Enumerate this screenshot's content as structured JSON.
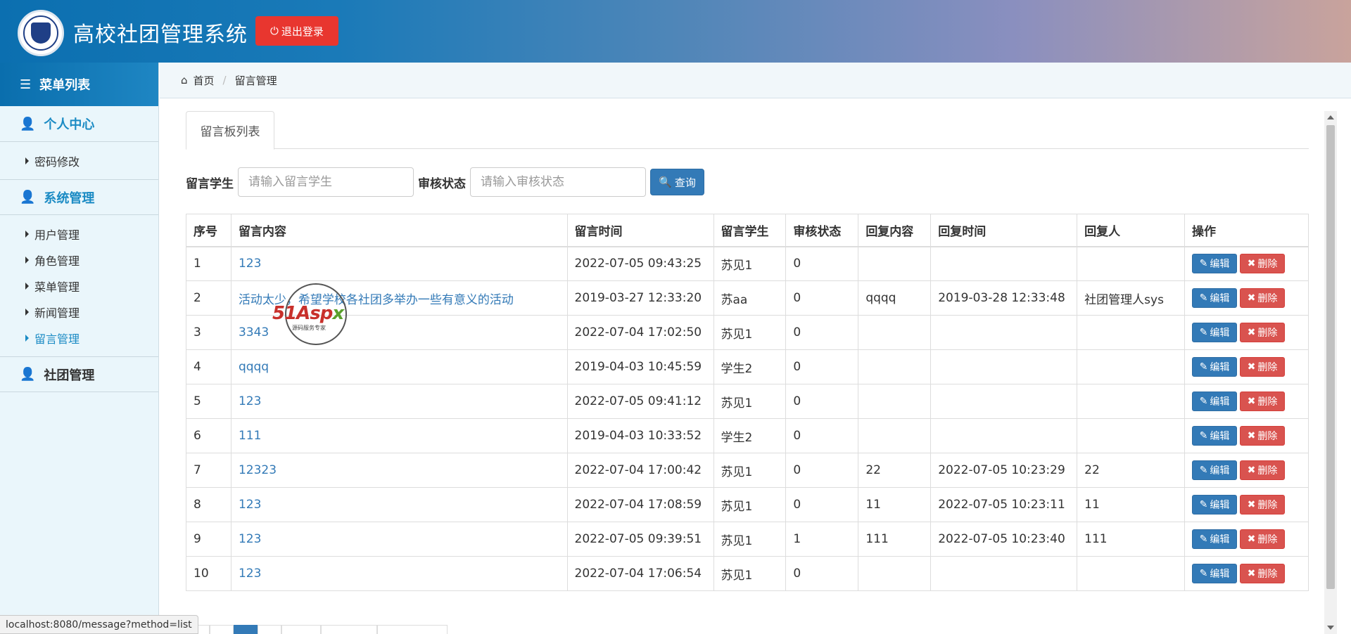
{
  "header": {
    "title": "高校社团管理系统",
    "logout_label": "退出登录"
  },
  "sidebar": {
    "menu_title": "菜单列表",
    "groups": [
      {
        "label": "个人中心",
        "items": [
          {
            "label": "密码修改"
          }
        ]
      },
      {
        "label": "系统管理",
        "items": [
          {
            "label": "用户管理"
          },
          {
            "label": "角色管理"
          },
          {
            "label": "菜单管理"
          },
          {
            "label": "新闻管理"
          },
          {
            "label": "留言管理"
          }
        ]
      },
      {
        "label": "社团管理",
        "items": []
      }
    ]
  },
  "breadcrumb": {
    "home": "首页",
    "current": "留言管理"
  },
  "tab_label": "留言板列表",
  "search": {
    "student_label": "留言学生",
    "student_placeholder": "请输入留言学生",
    "status_label": "审核状态",
    "status_placeholder": "请输入审核状态",
    "query_label": "查询"
  },
  "table": {
    "headers": [
      "序号",
      "留言内容",
      "留言时间",
      "留言学生",
      "审核状态",
      "回复内容",
      "回复时间",
      "回复人",
      "操作"
    ],
    "edit_label": "编辑",
    "delete_label": "删除",
    "rows": [
      [
        "1",
        "123",
        "2022-07-05 09:43:25",
        "苏见1",
        "0",
        "",
        "",
        ""
      ],
      [
        "2",
        "活动太少，希望学校各社团多举办一些有意义的活动",
        "2019-03-27 12:33:20",
        "苏aa",
        "0",
        "qqqq",
        "2019-03-28 12:33:48",
        "社团管理人sys"
      ],
      [
        "3",
        "3343",
        "2022-07-04 17:02:50",
        "苏见1",
        "0",
        "",
        "",
        ""
      ],
      [
        "4",
        "qqqq",
        "2019-04-03 10:45:59",
        "学生2",
        "0",
        "",
        "",
        ""
      ],
      [
        "5",
        "123",
        "2022-07-05 09:41:12",
        "苏见1",
        "0",
        "",
        "",
        ""
      ],
      [
        "6",
        "111",
        "2019-04-03 10:33:52",
        "学生2",
        "0",
        "",
        "",
        ""
      ],
      [
        "7",
        "12323",
        "2022-07-04 17:00:42",
        "苏见1",
        "0",
        "22",
        "2022-07-05 10:23:29",
        "22"
      ],
      [
        "8",
        "123",
        "2022-07-04 17:08:59",
        "苏见1",
        "0",
        "11",
        "2022-07-05 10:23:11",
        "11"
      ],
      [
        "9",
        "123",
        "2022-07-05 09:39:51",
        "苏见1",
        "1",
        "111",
        "2022-07-05 10:23:40",
        "111"
      ],
      [
        "10",
        "123",
        "2022-07-04 17:06:54",
        "苏见1",
        "0",
        "",
        "",
        ""
      ]
    ]
  },
  "watermark": {
    "brand_a": "51Asp",
    "brand_b": "x",
    "tagline": "源码服务专家"
  },
  "statusbar": {
    "url": "localhost:8080/message?method=list"
  }
}
